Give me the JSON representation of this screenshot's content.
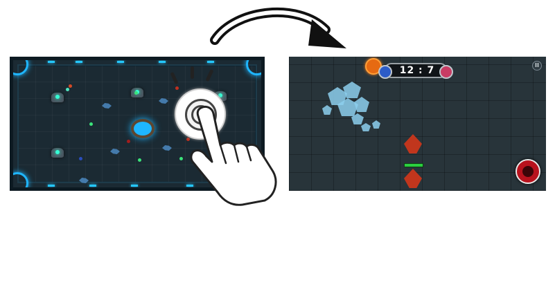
{
  "gameplay": {
    "score_display": "12 : 7",
    "pause_label": "II"
  },
  "icons": {
    "arrow": "curved-arrow-icon",
    "tap": "tap-gesture-icon",
    "hand": "hand-pointer-icon",
    "pause": "pause-icon",
    "attack": "attack-button-icon"
  },
  "colors": {
    "arena_bg": "#1b2a33",
    "accent_glow": "#1fb6ff",
    "team_blue": "#2c5cc8",
    "team_red": "#c83c64",
    "health_green": "#2bd03f"
  }
}
